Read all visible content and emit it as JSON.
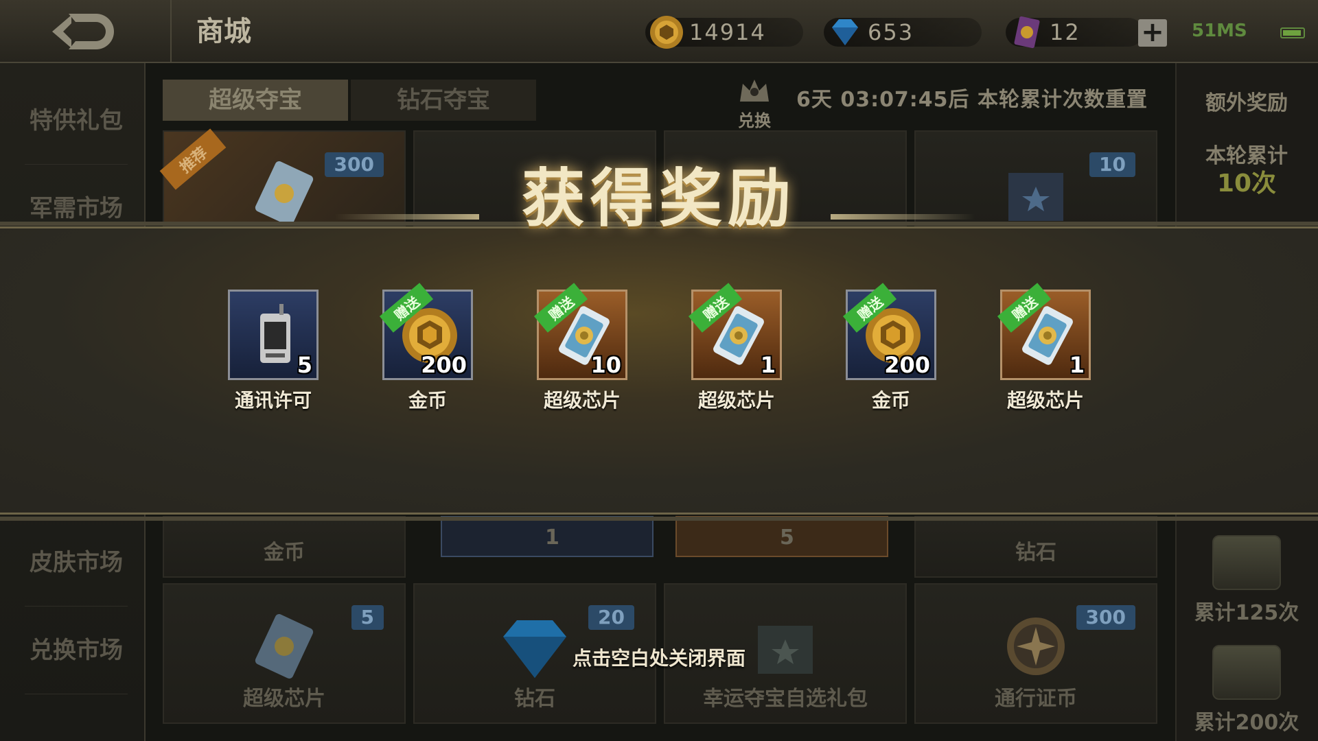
{
  "header": {
    "title": "商城",
    "coins": "14914",
    "diamonds": "653",
    "tickets": "12",
    "plus_label": "+",
    "signal": "51MS"
  },
  "sidebar": {
    "items": [
      {
        "label": "特供礼包"
      },
      {
        "label": "军需市场"
      },
      {
        "label": "皮肤市场"
      },
      {
        "label": "兑换市场"
      }
    ]
  },
  "tabs": [
    {
      "label": "超级夺宝",
      "active": true
    },
    {
      "label": "钻石夺宝",
      "active": false
    }
  ],
  "exchange_label": "兑换",
  "timer_text": "6天 03:07:45后 本轮累计次数重置",
  "right_panel": {
    "extra_title": "额外奖励",
    "round_label": "本轮累计",
    "round_count": "10次",
    "milestones": [
      {
        "label": "累计125次"
      },
      {
        "label": "累计200次"
      }
    ]
  },
  "shop_cards": {
    "top": [
      {
        "tag": "推荐",
        "qty": "300"
      },
      {
        "qty": ""
      },
      {
        "qty": ""
      },
      {
        "qty": "10"
      }
    ],
    "mid": [
      {
        "name": "金币"
      },
      {
        "qty": "1"
      },
      {
        "qty": "5"
      },
      {
        "name": "钻石"
      }
    ],
    "bottom": [
      {
        "name": "超级芯片",
        "qty": "5"
      },
      {
        "name": "钻石",
        "qty": "20"
      },
      {
        "name": "幸运夺宝自选礼包",
        "qty": ""
      },
      {
        "name": "通行证币",
        "qty": "300"
      }
    ]
  },
  "reward_overlay": {
    "title": "获得奖励",
    "gift_tag": "赠送",
    "items": [
      {
        "name": "通讯许可",
        "count": "5",
        "icon": "radio-icon",
        "style": "blue",
        "gift": false
      },
      {
        "name": "金币",
        "count": "200",
        "icon": "gold-coin-icon",
        "style": "blue",
        "gift": true
      },
      {
        "name": "超级芯片",
        "count": "10",
        "icon": "chip-icon",
        "style": "orange",
        "gift": true
      },
      {
        "name": "超级芯片",
        "count": "1",
        "icon": "chip-icon",
        "style": "orange",
        "gift": true
      },
      {
        "name": "金币",
        "count": "200",
        "icon": "gold-coin-icon",
        "style": "blue",
        "gift": true
      },
      {
        "name": "超级芯片",
        "count": "1",
        "icon": "chip-icon",
        "style": "orange",
        "gift": true
      }
    ],
    "close_hint": "点击空白处关闭界面"
  },
  "colors": {
    "accent_gold": "#f2e7c4",
    "gift_green": "#3bb039",
    "qty_blue": "#2c4a67"
  }
}
